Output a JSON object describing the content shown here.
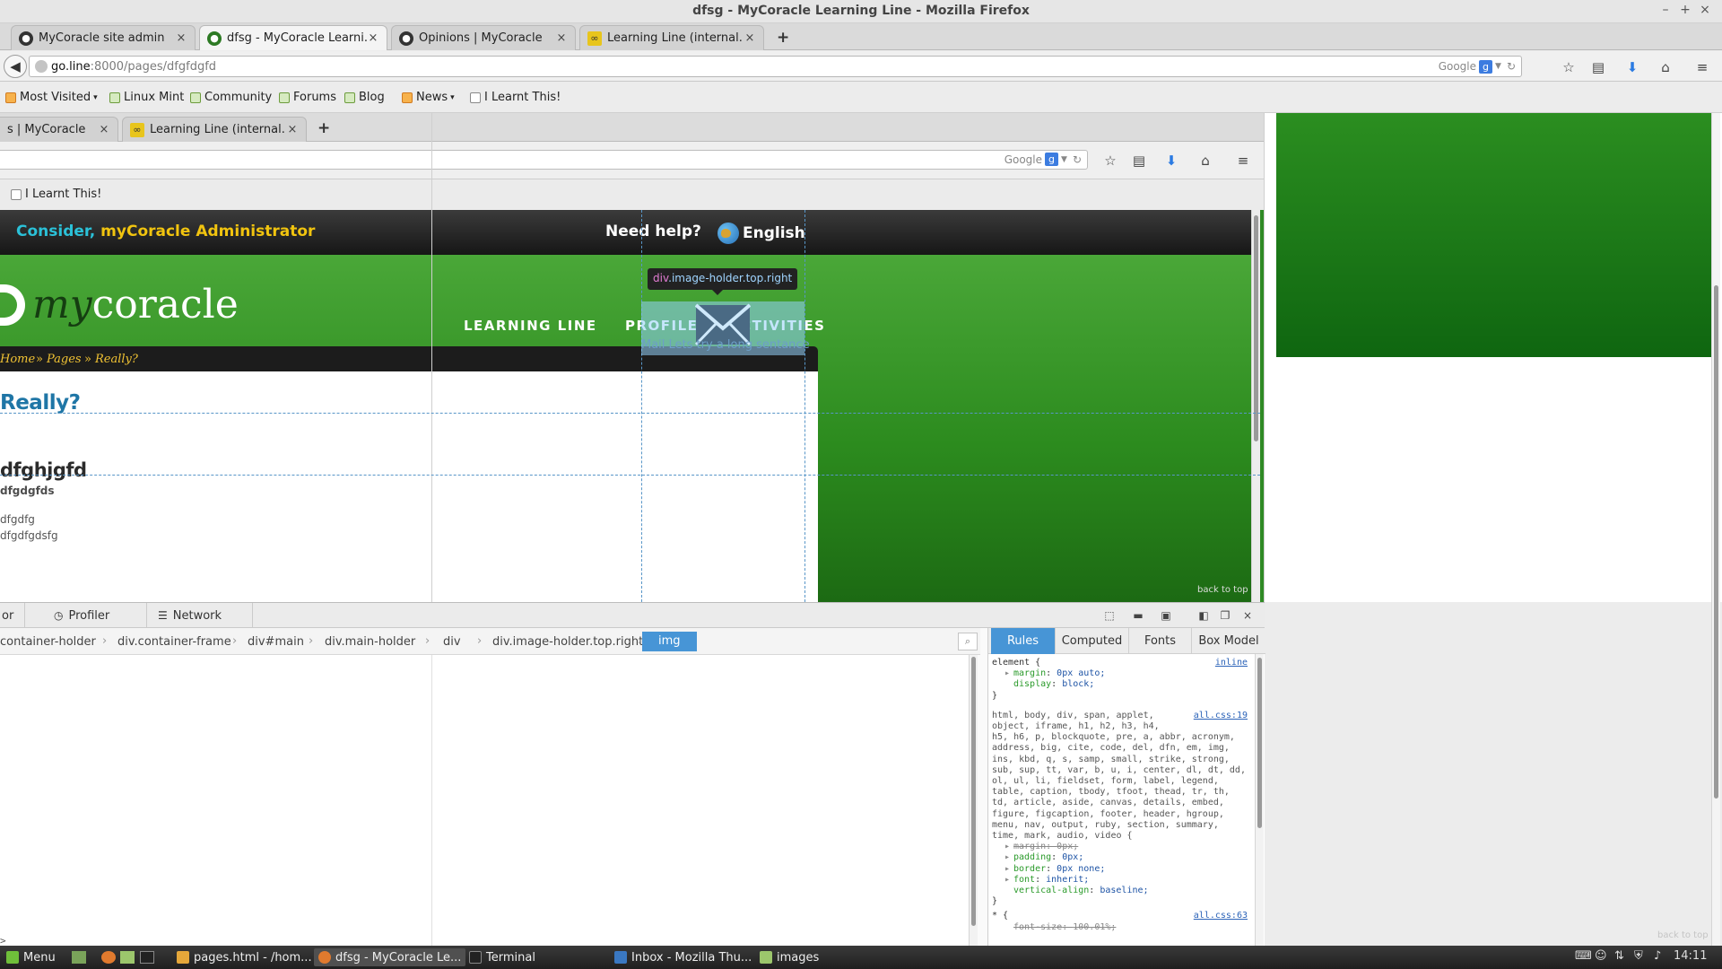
{
  "window": {
    "title": "dfsg - MyCoracle Learning Line - Mozilla Firefox",
    "controls": [
      "–",
      "+",
      "×"
    ]
  },
  "tabs": [
    {
      "label": "MyCoracle site admin",
      "close": "×",
      "icon": "mycoracle-icon"
    },
    {
      "label": "dfsg - MyCoracle Learni...",
      "close": "×",
      "icon": "mycoracle-icon"
    },
    {
      "label": "Opinions | MyCoracle",
      "close": "×",
      "icon": "mycoracle-icon"
    },
    {
      "label": "Learning Line (internal...",
      "close": "×",
      "icon": "learning-line-icon"
    }
  ],
  "new_tab": "+",
  "navbar": {
    "url_host": "go.line",
    "url_path": ":8000/pages/dfgfdgfd",
    "search_engine": "Google"
  },
  "bookmarks": [
    {
      "label": "Most Visited",
      "dropdown": "▾"
    },
    {
      "label": "Linux Mint"
    },
    {
      "label": "Community"
    },
    {
      "label": "Forums"
    },
    {
      "label": "Blog"
    },
    {
      "label": "News",
      "dropdown": "▾"
    },
    {
      "label": "I Learnt This!"
    }
  ],
  "inner_browser": {
    "tabs": [
      {
        "label": "s | MyCoracle",
        "close": "×"
      },
      {
        "label": "Learning Line (internal...",
        "close": "×"
      }
    ],
    "new_tab": "+",
    "search_engine": "Google",
    "bookmark": "I Learnt This!"
  },
  "site": {
    "top_msg_prefix": "Consider, ",
    "top_msg_user": "myCoracle Administrator",
    "need_help": "Need help?",
    "language": "English",
    "logo_my": "my",
    "logo_rest": "coracle",
    "nav": [
      "LEARNING LINE",
      "PROFILE",
      "ACTIVITIES"
    ],
    "breadcrumb": [
      "Home",
      "Pages",
      "Really?"
    ],
    "breadcrumb_sep": "»",
    "heading": "Really?",
    "subheading": "dfghjgfd",
    "h3": "dfgdgfds",
    "p1": "dfgdfg",
    "p2": "dfgdfgdsfg",
    "mail_text": "Mail Lets try a long sentance",
    "back_to_top": "back to top"
  },
  "inspector": {
    "tooltip_tag": "div",
    "tooltip_class": ".image-holder.top.right",
    "tabs": [
      {
        "label": "or",
        "icon": ""
      },
      {
        "label": "Profiler",
        "icon": "◷"
      },
      {
        "label": "Network",
        "icon": "☰"
      }
    ],
    "breadcrumbs": [
      "container-holder",
      "div.container-frame",
      "div#main",
      "div.main-holder",
      "div",
      "div.image-holder.top.right",
      "img"
    ],
    "rule_tabs": [
      "Rules",
      "Computed",
      "Fonts",
      "Box Model"
    ],
    "rules": {
      "r1_sel": "element {",
      "r1_src": "inline",
      "r1_p1": "margin",
      "r1_v1": "0px auto;",
      "r1_p2": "display",
      "r1_v2": "block;",
      "close": "}",
      "r2_src": "all.css:19",
      "r2_sel_1": "html, body, div, span, applet,",
      "r2_sel_2": "object, iframe, h1, h2, h3, h4,",
      "r2_sel_3": "h5, h6, p, blockquote, pre, a, abbr, acronym,",
      "r2_sel_4": "address, big, cite, code, del, dfn, em, img,",
      "r2_sel_5": "ins, kbd, q, s, samp, small, strike, strong,",
      "r2_sel_6": "sub, sup, tt, var, b, u, i, center, dl, dt, dd,",
      "r2_sel_7": "ol, ul, li, fieldset, form, label, legend,",
      "r2_sel_8": "table, caption, tbody, tfoot, thead, tr, th,",
      "r2_sel_9": "td, article, aside, canvas, details, embed,",
      "r2_sel_10": "figure, figcaption, footer, header, hgroup,",
      "r2_sel_11": "menu, nav, output, ruby, section, summary,",
      "r2_sel_12": "time, mark, audio, video {",
      "r2_p1": "margin",
      "r2_v1": "0px;",
      "r2_p2": "padding",
      "r2_v2": "0px;",
      "r2_p3": "border",
      "r2_v3": "0px none;",
      "r2_p4": "font",
      "r2_v4": "inherit;",
      "r2_p5": "vertical-align",
      "r2_v5": "baseline;",
      "r3_sel": "* {",
      "r3_src": "all.css:63",
      "r3_p1": "font-size",
      "r3_v1": "100.01%;"
    },
    "console_prompt": ">"
  },
  "right_panel": {
    "back_to_top": "back to top"
  },
  "taskbar": {
    "menu": "Menu",
    "tasks": [
      {
        "label": "pages.html - /hom..."
      },
      {
        "label": "dfsg - MyCoracle Le..."
      },
      {
        "label": "Terminal"
      },
      {
        "label": "Inbox - Mozilla Thu..."
      },
      {
        "label": "images"
      }
    ],
    "clock": "14:11"
  },
  "colors": {
    "site_green": "#3d9c2e",
    "strip_cyan": "#2bc1d8",
    "strip_yellow": "#f1c40f",
    "heading_blue": "#1f76a6",
    "inspector_blue": "#4795d6"
  }
}
